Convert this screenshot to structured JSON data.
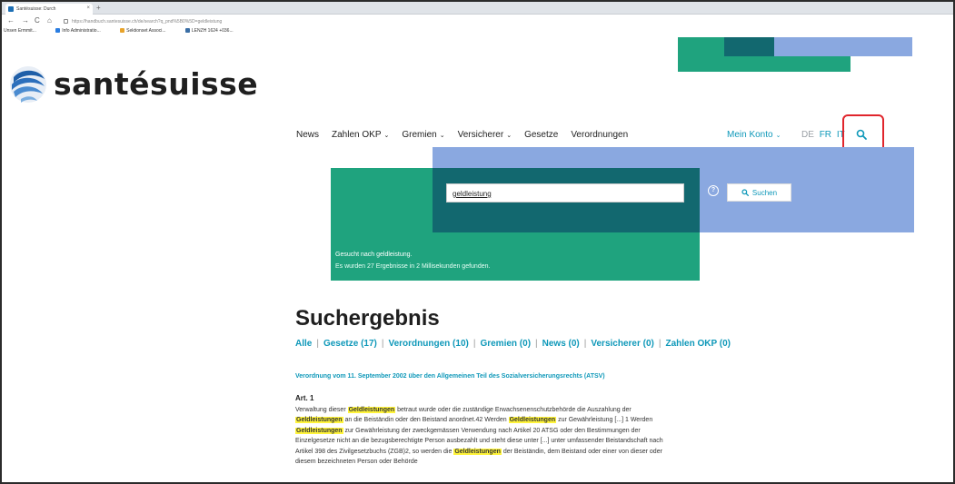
{
  "browser": {
    "tab_title": "Santésuisse: Durch",
    "tab_close": "×",
    "new_tab": "+",
    "nav": {
      "back": "←",
      "forward": "→",
      "reload": "C",
      "home": "⌂"
    },
    "url": "https://handbuch.santesuisse.ch/de/search?q_pnd%5B0%5D=geldleistung",
    "bookmarks": [
      "Unsen Ermmit...",
      "Info Administratio...",
      "Sektionset Associ...",
      "LENZH 1624 +036..."
    ]
  },
  "site": {
    "logo_text": "santésuisse",
    "nav": [
      {
        "label": "News",
        "chevron": false
      },
      {
        "label": "Zahlen OKP",
        "chevron": true
      },
      {
        "label": "Gremien",
        "chevron": true
      },
      {
        "label": "Versicherer",
        "chevron": true
      },
      {
        "label": "Gesetze",
        "chevron": false
      },
      {
        "label": "Verordnungen",
        "chevron": false
      }
    ],
    "account": "Mein Konto",
    "chevron_glyph": "⌄",
    "languages": [
      {
        "code": "DE",
        "active": false
      },
      {
        "code": "FR",
        "active": true
      },
      {
        "code": "IT",
        "active": true
      }
    ],
    "colors": {
      "teal": "#0e98b9",
      "green": "#1fa37e",
      "dark_teal": "#12686f",
      "blue": "#8aa8e0",
      "highlight_box": "#e0252c"
    }
  },
  "search": {
    "query": "geldleistung",
    "help": "?",
    "button_label": "Suchen",
    "status_line1": "Gesucht nach geldleistung.",
    "status_line2": "Es wurden 27 Ergebnisse in 2 Millisekunden gefunden."
  },
  "results": {
    "heading": "Suchergebnis",
    "filters": [
      "Alle",
      "Gesetze (17)",
      "Verordnungen (10)",
      "Gremien (0)",
      "News (0)",
      "Versicherer (0)",
      "Zahlen OKP (0)"
    ],
    "separator": "|",
    "items": [
      {
        "title": "Verordnung vom 11. September 2002 über den Allgemeinen Teil des Sozialversicherungsrechts (ATSV)",
        "article": "Art. 1",
        "excerpt_parts": [
          {
            "t": "Verwaltung dieser ",
            "h": false
          },
          {
            "t": "Geldleistungen",
            "h": true
          },
          {
            "t": " betraut wurde oder die zuständige Erwachsenenschutzbehörde die Auszahlung der ",
            "h": false
          },
          {
            "t": "Geldleistungen",
            "h": true
          },
          {
            "t": " an die Beiständin oder den Beistand anordnet.42 Werden ",
            "h": false
          },
          {
            "t": "Geldleistungen",
            "h": true
          },
          {
            "t": " zur Gewährleistung [...] 1 Werden ",
            "h": false
          },
          {
            "t": "Geldleistungen",
            "h": true
          },
          {
            "t": " zur Gewährleistung der zweckgemässen Verwendung nach Artikel 20 ATSG oder den Bestimmungen der Einzelgesetze nicht an die bezugsberechtigte Person ausbezahlt und steht diese unter [...] unter umfassender Beistandschaft nach Artikel 398 des Zivilgesetzbuchs (ZGB)2, so werden die ",
            "h": false
          },
          {
            "t": "Geldleistungen",
            "h": true
          },
          {
            "t": " der Beiständin, dem Beistand oder einer von dieser oder diesem bezeichneten Person oder Behörde",
            "h": false
          }
        ]
      }
    ]
  }
}
